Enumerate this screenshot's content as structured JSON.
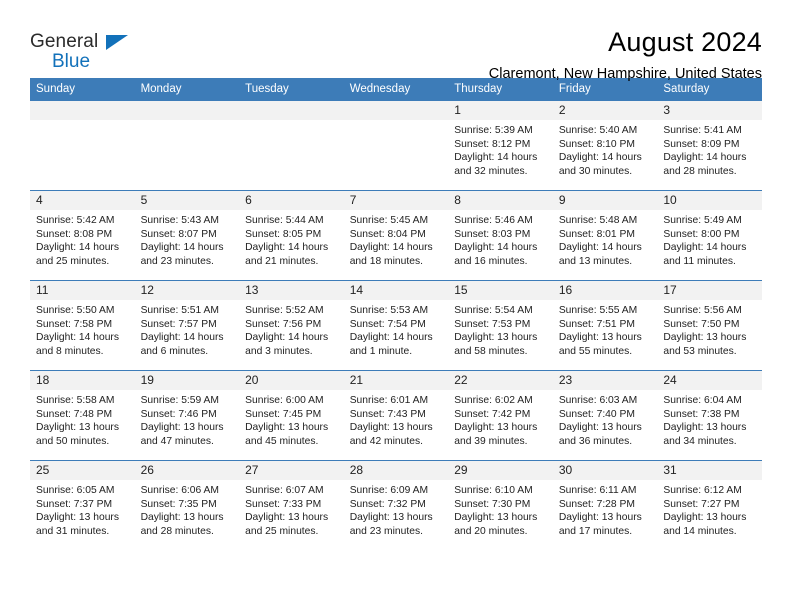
{
  "brand": {
    "line1": "General",
    "line2": "Blue",
    "triangle_color": "#1271ba"
  },
  "header": {
    "title": "August 2024",
    "subtitle": "Claremont, New Hampshire, United States"
  },
  "colors": {
    "header_blue": "#3d7cb8",
    "daynum_band": "#f2f2f2",
    "brand_blue": "#1271ba",
    "text": "#222222"
  },
  "weekday_headers": [
    "Sunday",
    "Monday",
    "Tuesday",
    "Wednesday",
    "Thursday",
    "Friday",
    "Saturday"
  ],
  "weeks": [
    [
      {
        "day": "",
        "empty": true,
        "sunrise": "",
        "sunset": "",
        "daylight1": "",
        "daylight2": ""
      },
      {
        "day": "",
        "empty": true,
        "sunrise": "",
        "sunset": "",
        "daylight1": "",
        "daylight2": ""
      },
      {
        "day": "",
        "empty": true,
        "sunrise": "",
        "sunset": "",
        "daylight1": "",
        "daylight2": ""
      },
      {
        "day": "",
        "empty": true,
        "sunrise": "",
        "sunset": "",
        "daylight1": "",
        "daylight2": ""
      },
      {
        "day": "1",
        "empty": false,
        "sunrise": "Sunrise: 5:39 AM",
        "sunset": "Sunset: 8:12 PM",
        "daylight1": "Daylight: 14 hours",
        "daylight2": "and 32 minutes."
      },
      {
        "day": "2",
        "empty": false,
        "sunrise": "Sunrise: 5:40 AM",
        "sunset": "Sunset: 8:10 PM",
        "daylight1": "Daylight: 14 hours",
        "daylight2": "and 30 minutes."
      },
      {
        "day": "3",
        "empty": false,
        "sunrise": "Sunrise: 5:41 AM",
        "sunset": "Sunset: 8:09 PM",
        "daylight1": "Daylight: 14 hours",
        "daylight2": "and 28 minutes."
      }
    ],
    [
      {
        "day": "4",
        "empty": false,
        "sunrise": "Sunrise: 5:42 AM",
        "sunset": "Sunset: 8:08 PM",
        "daylight1": "Daylight: 14 hours",
        "daylight2": "and 25 minutes."
      },
      {
        "day": "5",
        "empty": false,
        "sunrise": "Sunrise: 5:43 AM",
        "sunset": "Sunset: 8:07 PM",
        "daylight1": "Daylight: 14 hours",
        "daylight2": "and 23 minutes."
      },
      {
        "day": "6",
        "empty": false,
        "sunrise": "Sunrise: 5:44 AM",
        "sunset": "Sunset: 8:05 PM",
        "daylight1": "Daylight: 14 hours",
        "daylight2": "and 21 minutes."
      },
      {
        "day": "7",
        "empty": false,
        "sunrise": "Sunrise: 5:45 AM",
        "sunset": "Sunset: 8:04 PM",
        "daylight1": "Daylight: 14 hours",
        "daylight2": "and 18 minutes."
      },
      {
        "day": "8",
        "empty": false,
        "sunrise": "Sunrise: 5:46 AM",
        "sunset": "Sunset: 8:03 PM",
        "daylight1": "Daylight: 14 hours",
        "daylight2": "and 16 minutes."
      },
      {
        "day": "9",
        "empty": false,
        "sunrise": "Sunrise: 5:48 AM",
        "sunset": "Sunset: 8:01 PM",
        "daylight1": "Daylight: 14 hours",
        "daylight2": "and 13 minutes."
      },
      {
        "day": "10",
        "empty": false,
        "sunrise": "Sunrise: 5:49 AM",
        "sunset": "Sunset: 8:00 PM",
        "daylight1": "Daylight: 14 hours",
        "daylight2": "and 11 minutes."
      }
    ],
    [
      {
        "day": "11",
        "empty": false,
        "sunrise": "Sunrise: 5:50 AM",
        "sunset": "Sunset: 7:58 PM",
        "daylight1": "Daylight: 14 hours",
        "daylight2": "and 8 minutes."
      },
      {
        "day": "12",
        "empty": false,
        "sunrise": "Sunrise: 5:51 AM",
        "sunset": "Sunset: 7:57 PM",
        "daylight1": "Daylight: 14 hours",
        "daylight2": "and 6 minutes."
      },
      {
        "day": "13",
        "empty": false,
        "sunrise": "Sunrise: 5:52 AM",
        "sunset": "Sunset: 7:56 PM",
        "daylight1": "Daylight: 14 hours",
        "daylight2": "and 3 minutes."
      },
      {
        "day": "14",
        "empty": false,
        "sunrise": "Sunrise: 5:53 AM",
        "sunset": "Sunset: 7:54 PM",
        "daylight1": "Daylight: 14 hours",
        "daylight2": "and 1 minute."
      },
      {
        "day": "15",
        "empty": false,
        "sunrise": "Sunrise: 5:54 AM",
        "sunset": "Sunset: 7:53 PM",
        "daylight1": "Daylight: 13 hours",
        "daylight2": "and 58 minutes."
      },
      {
        "day": "16",
        "empty": false,
        "sunrise": "Sunrise: 5:55 AM",
        "sunset": "Sunset: 7:51 PM",
        "daylight1": "Daylight: 13 hours",
        "daylight2": "and 55 minutes."
      },
      {
        "day": "17",
        "empty": false,
        "sunrise": "Sunrise: 5:56 AM",
        "sunset": "Sunset: 7:50 PM",
        "daylight1": "Daylight: 13 hours",
        "daylight2": "and 53 minutes."
      }
    ],
    [
      {
        "day": "18",
        "empty": false,
        "sunrise": "Sunrise: 5:58 AM",
        "sunset": "Sunset: 7:48 PM",
        "daylight1": "Daylight: 13 hours",
        "daylight2": "and 50 minutes."
      },
      {
        "day": "19",
        "empty": false,
        "sunrise": "Sunrise: 5:59 AM",
        "sunset": "Sunset: 7:46 PM",
        "daylight1": "Daylight: 13 hours",
        "daylight2": "and 47 minutes."
      },
      {
        "day": "20",
        "empty": false,
        "sunrise": "Sunrise: 6:00 AM",
        "sunset": "Sunset: 7:45 PM",
        "daylight1": "Daylight: 13 hours",
        "daylight2": "and 45 minutes."
      },
      {
        "day": "21",
        "empty": false,
        "sunrise": "Sunrise: 6:01 AM",
        "sunset": "Sunset: 7:43 PM",
        "daylight1": "Daylight: 13 hours",
        "daylight2": "and 42 minutes."
      },
      {
        "day": "22",
        "empty": false,
        "sunrise": "Sunrise: 6:02 AM",
        "sunset": "Sunset: 7:42 PM",
        "daylight1": "Daylight: 13 hours",
        "daylight2": "and 39 minutes."
      },
      {
        "day": "23",
        "empty": false,
        "sunrise": "Sunrise: 6:03 AM",
        "sunset": "Sunset: 7:40 PM",
        "daylight1": "Daylight: 13 hours",
        "daylight2": "and 36 minutes."
      },
      {
        "day": "24",
        "empty": false,
        "sunrise": "Sunrise: 6:04 AM",
        "sunset": "Sunset: 7:38 PM",
        "daylight1": "Daylight: 13 hours",
        "daylight2": "and 34 minutes."
      }
    ],
    [
      {
        "day": "25",
        "empty": false,
        "sunrise": "Sunrise: 6:05 AM",
        "sunset": "Sunset: 7:37 PM",
        "daylight1": "Daylight: 13 hours",
        "daylight2": "and 31 minutes."
      },
      {
        "day": "26",
        "empty": false,
        "sunrise": "Sunrise: 6:06 AM",
        "sunset": "Sunset: 7:35 PM",
        "daylight1": "Daylight: 13 hours",
        "daylight2": "and 28 minutes."
      },
      {
        "day": "27",
        "empty": false,
        "sunrise": "Sunrise: 6:07 AM",
        "sunset": "Sunset: 7:33 PM",
        "daylight1": "Daylight: 13 hours",
        "daylight2": "and 25 minutes."
      },
      {
        "day": "28",
        "empty": false,
        "sunrise": "Sunrise: 6:09 AM",
        "sunset": "Sunset: 7:32 PM",
        "daylight1": "Daylight: 13 hours",
        "daylight2": "and 23 minutes."
      },
      {
        "day": "29",
        "empty": false,
        "sunrise": "Sunrise: 6:10 AM",
        "sunset": "Sunset: 7:30 PM",
        "daylight1": "Daylight: 13 hours",
        "daylight2": "and 20 minutes."
      },
      {
        "day": "30",
        "empty": false,
        "sunrise": "Sunrise: 6:11 AM",
        "sunset": "Sunset: 7:28 PM",
        "daylight1": "Daylight: 13 hours",
        "daylight2": "and 17 minutes."
      },
      {
        "day": "31",
        "empty": false,
        "sunrise": "Sunrise: 6:12 AM",
        "sunset": "Sunset: 7:27 PM",
        "daylight1": "Daylight: 13 hours",
        "daylight2": "and 14 minutes."
      }
    ]
  ]
}
